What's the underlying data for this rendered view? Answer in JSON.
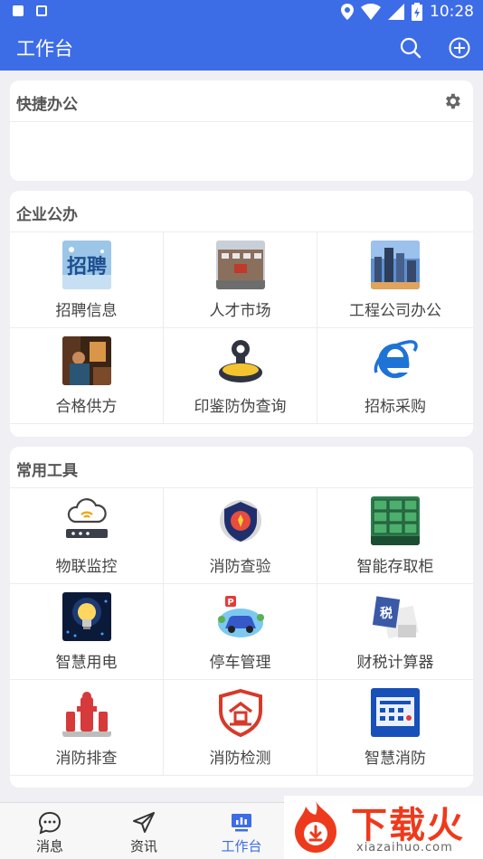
{
  "status_bar": {
    "time": "10:28"
  },
  "app_bar": {
    "title": "工作台"
  },
  "sections": {
    "quick_office": {
      "title": "快捷办公"
    },
    "enterprise": {
      "title": "企业公办",
      "items": [
        {
          "label": "招聘信息",
          "icon": "recruitment-icon"
        },
        {
          "label": "人才市场",
          "icon": "talent-market-icon"
        },
        {
          "label": "工程公司办公",
          "icon": "engineering-office-icon"
        },
        {
          "label": "合格供方",
          "icon": "qualified-supplier-icon"
        },
        {
          "label": "印鉴防伪查询",
          "icon": "seal-stamp-icon"
        },
        {
          "label": "招标采购",
          "icon": "internet-explorer-icon"
        }
      ]
    },
    "tools": {
      "title": "常用工具",
      "items": [
        {
          "label": "物联监控",
          "icon": "iot-cloud-router-icon"
        },
        {
          "label": "消防查验",
          "icon": "fire-badge-icon"
        },
        {
          "label": "智能存取柜",
          "icon": "smart-locker-icon"
        },
        {
          "label": "智慧用电",
          "icon": "light-bulb-icon"
        },
        {
          "label": "停车管理",
          "icon": "parking-car-icon"
        },
        {
          "label": "财税计算器",
          "icon": "tax-calculator-icon"
        },
        {
          "label": "消防排查",
          "icon": "fire-hydrant-icon"
        },
        {
          "label": "消防检测",
          "icon": "fire-inspection-shield-icon"
        },
        {
          "label": "智慧消防",
          "icon": "smart-fire-board-icon"
        }
      ]
    }
  },
  "bottom_nav": {
    "tabs": [
      {
        "label": "消息",
        "icon": "message-bubble-icon"
      },
      {
        "label": "资讯",
        "icon": "paper-plane-icon"
      },
      {
        "label": "工作台",
        "icon": "dashboard-icon",
        "active": true
      }
    ]
  },
  "watermark": {
    "title": "下载火",
    "subtitle": "xiazaihuo.com"
  },
  "colors": {
    "primary": "#3d6ce7",
    "accent_red": "#ee3a1c",
    "background": "#efeff4"
  }
}
